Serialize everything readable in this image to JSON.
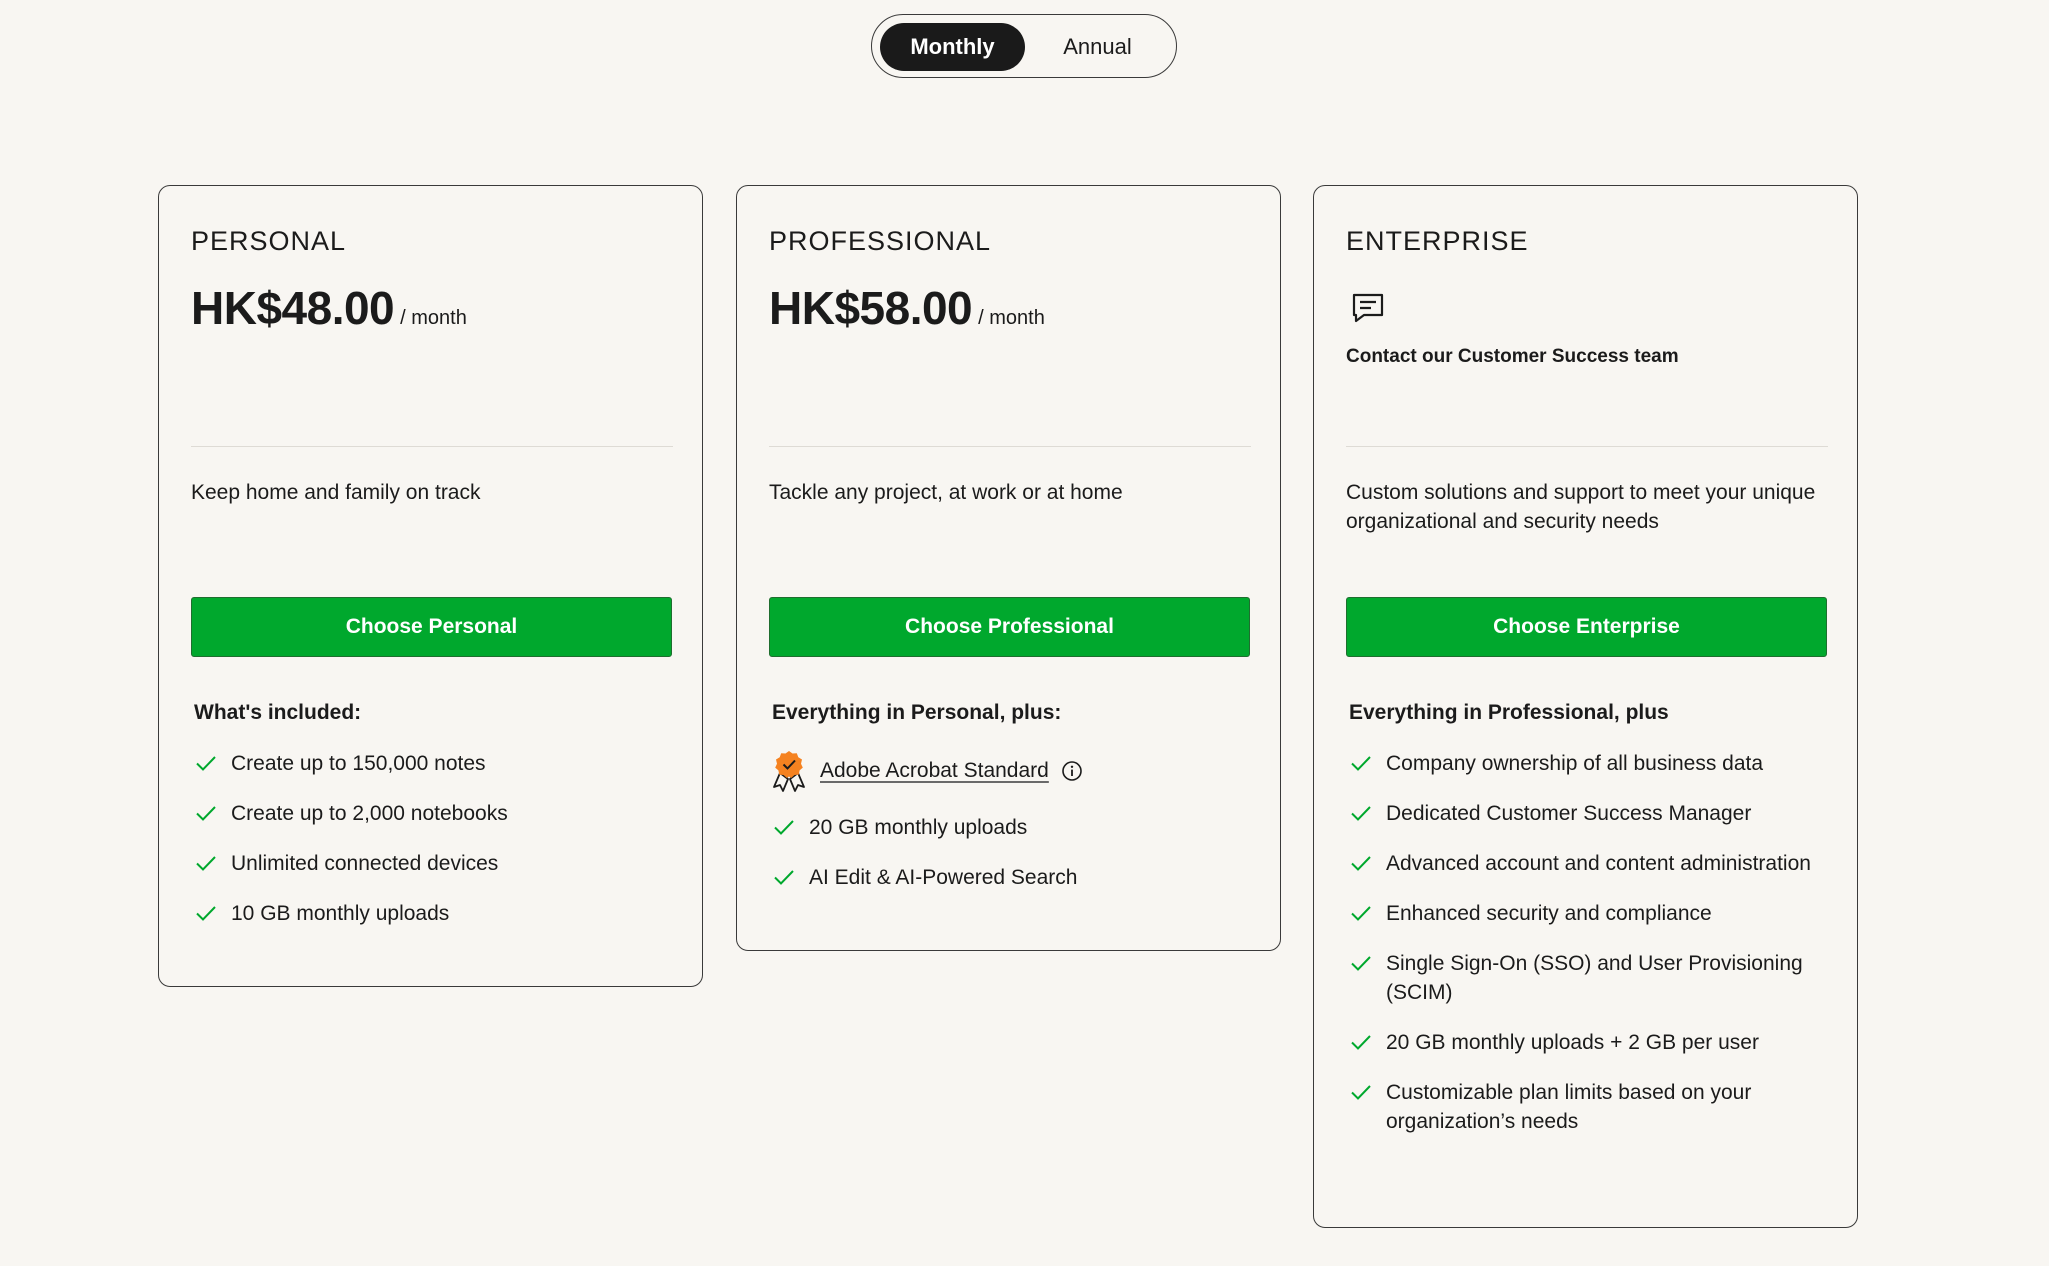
{
  "billing_toggle": {
    "options": [
      "Monthly",
      "Annual"
    ],
    "selected": "Monthly"
  },
  "plans": [
    {
      "tier": "PERSONAL",
      "price": "HK$48.00",
      "period": "/ month",
      "tagline": "Keep home and family on track",
      "cta": "Choose Personal",
      "included_heading": "What's included:",
      "features": [
        "Create up to 150,000 notes",
        "Create up to 2,000 notebooks",
        "Unlimited connected devices",
        "10 GB monthly uploads"
      ]
    },
    {
      "tier": "PROFESSIONAL",
      "price": "HK$58.00",
      "period": "/ month",
      "tagline": "Tackle any project, at work or at home",
      "cta": "Choose Professional",
      "included_heading": "Everything in Personal, plus:",
      "special_feature": "Adobe Acrobat Standard",
      "features": [
        "20 GB monthly uploads",
        "AI Edit & AI-Powered Search"
      ]
    },
    {
      "tier": "ENTERPRISE",
      "contact_text": "Contact our Customer Success team",
      "tagline": "Custom solutions and support to meet your unique organizational and security needs",
      "cta": "Choose Enterprise",
      "included_heading": "Everything in Professional, plus",
      "features": [
        "Company ownership of all business data",
        "Dedicated Customer Success Manager",
        "Advanced account and content administration",
        "Enhanced security and compliance",
        "Single Sign-On (SSO) and User Provisioning (SCIM)",
        "20 GB monthly uploads + 2 GB per user",
        "Customizable plan limits based on your organization’s needs"
      ]
    }
  ],
  "icons": {
    "check": "check-icon",
    "contact": "chat-bubble-icon",
    "badge": "award-badge-icon",
    "info": "info-icon"
  },
  "colors": {
    "background": "#f8f6f2",
    "cta_green": "#00a82d",
    "check_green": "#00a82d",
    "toggle_active": "#1a1a1a",
    "badge_orange": "#f58220"
  }
}
